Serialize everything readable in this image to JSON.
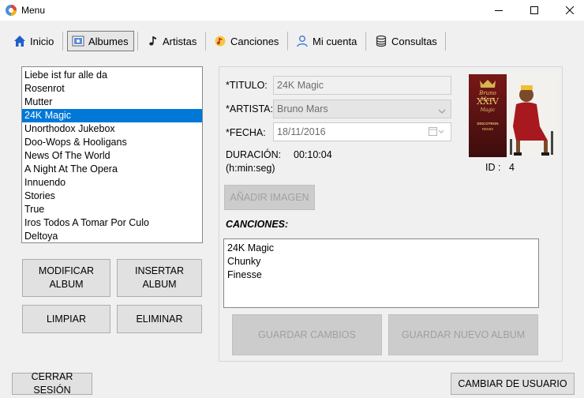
{
  "window": {
    "title": "Menu"
  },
  "tabs": [
    {
      "label": "Inicio",
      "icon": "home-icon"
    },
    {
      "label": "Albumes",
      "icon": "album-icon"
    },
    {
      "label": "Artistas",
      "icon": "music-note-icon"
    },
    {
      "label": "Canciones",
      "icon": "song-icon"
    },
    {
      "label": "Mi cuenta",
      "icon": "user-icon"
    },
    {
      "label": "Consultas",
      "icon": "query-icon"
    }
  ],
  "albums": [
    "Liebe ist fur alle da",
    "Rosenrot",
    "Mutter",
    "24K Magic",
    "Unorthodox Jukebox",
    "Doo-Wops & Hooligans",
    "News Of The World",
    "A Night At The Opera",
    "Innuendo",
    "Stories",
    "True",
    "Iros Todos A Tomar Por Culo",
    "Deltoya"
  ],
  "selected_album_index": 3,
  "buttons": {
    "modify": "MODIFICAR ALBUM",
    "insert": "INSERTAR ALBUM",
    "clear": "LIMPIAR",
    "delete": "ELIMINAR",
    "add_image": "AÑADIR IMAGEN",
    "save_changes": "GUARDAR CAMBIOS",
    "save_new": "GUARDAR NUEVO ALBUM",
    "logout": "CERRAR SESIÓN",
    "switch_user": "CAMBIAR DE USUARIO"
  },
  "form": {
    "title_label": "*TITULO:",
    "title_value": "24K Magic",
    "artist_label": "*ARTISTA:",
    "artist_value": "Bruno Mars",
    "date_label": "*FECHA:",
    "date_value": "18/11/2016",
    "duration_label": "DURACIÓN:",
    "duration_value": "00:10:04",
    "duration_format": "(h:min:seg)",
    "id_label": "ID :",
    "id_value": "4",
    "songs_label": "CANCIONES:"
  },
  "cover": {
    "line1": "Bruno Mars",
    "line2": "XXIV",
    "line3": "Magic",
    "line4": "DISCOTRON",
    "line5": "REMIX"
  },
  "songs": [
    "24K Magic",
    "Chunky",
    "Finesse"
  ],
  "colors": {
    "selection": "#0078d7",
    "disabled_text": "#a0a0a0"
  }
}
